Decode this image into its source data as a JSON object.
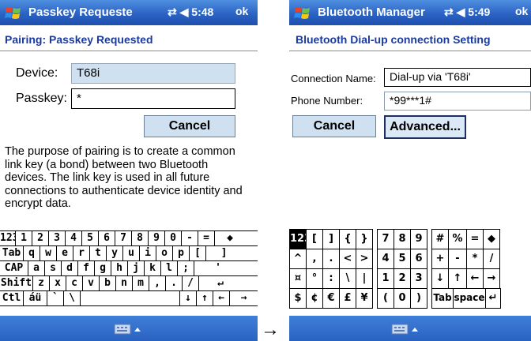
{
  "left": {
    "title": "Passkey Requeste",
    "time_icons": "⇄ ◀ 5:48",
    "ok": "ok",
    "header": "Pairing: Passkey Requested",
    "device_label": "Device:",
    "device_value": "T68i",
    "passkey_label": "Passkey:",
    "passkey_value": "*",
    "cancel": "Cancel",
    "description": "The purpose of pairing is to create a common link key (a bond) between two Bluetooth devices. The link key is used in all future connections to authenticate device identity and encrypt data.",
    "keyboard_rows": [
      [
        "123",
        "1",
        "2",
        "3",
        "4",
        "5",
        "6",
        "7",
        "8",
        "9",
        "0",
        "-",
        "=",
        "◆"
      ],
      [
        "Tab",
        "q",
        "w",
        "e",
        "r",
        "t",
        "y",
        "u",
        "i",
        "o",
        "p",
        "[",
        "]"
      ],
      [
        "CAP",
        "a",
        "s",
        "d",
        "f",
        "g",
        "h",
        "j",
        "k",
        "l",
        ";",
        "'"
      ],
      [
        "Shift",
        "z",
        "x",
        "c",
        "v",
        "b",
        "n",
        "m",
        ",",
        ".",
        "/",
        "↵"
      ],
      [
        "Ctl",
        "áü",
        "`",
        "\\",
        "",
        "↓",
        "↑",
        "←",
        "→"
      ]
    ]
  },
  "arrow": "→",
  "right": {
    "title": "Bluetooth Manager",
    "time_icons": "⇄ ◀ 5:49",
    "ok": "ok",
    "header": "Bluetooth Dial-up connection Setting",
    "conn_label": "Connection Name:",
    "conn_value": "Dial-up via 'T68i'",
    "phone_label": "Phone Number:",
    "phone_value": "*99***1#",
    "cancel": "Cancel",
    "advanced": "Advanced...",
    "keyboard_rows": [
      [
        "123",
        "[",
        "]",
        "{",
        "}",
        "|",
        "7",
        "8",
        "9",
        "|",
        "#",
        "%",
        "=",
        "◆"
      ],
      [
        "^",
        ",",
        ".",
        "<",
        ">",
        "|",
        "4",
        "5",
        "6",
        "|",
        "+",
        "-",
        "*",
        "/"
      ],
      [
        "¤",
        "°",
        ":",
        "\\",
        "|",
        "|",
        "1",
        "2",
        "3",
        "|",
        "↓",
        "↑",
        "←",
        "→"
      ],
      [
        "$",
        "¢",
        "€",
        "£",
        "¥",
        "|",
        "(",
        "0",
        ")",
        "|",
        "Tab",
        "space",
        "↵"
      ]
    ]
  }
}
